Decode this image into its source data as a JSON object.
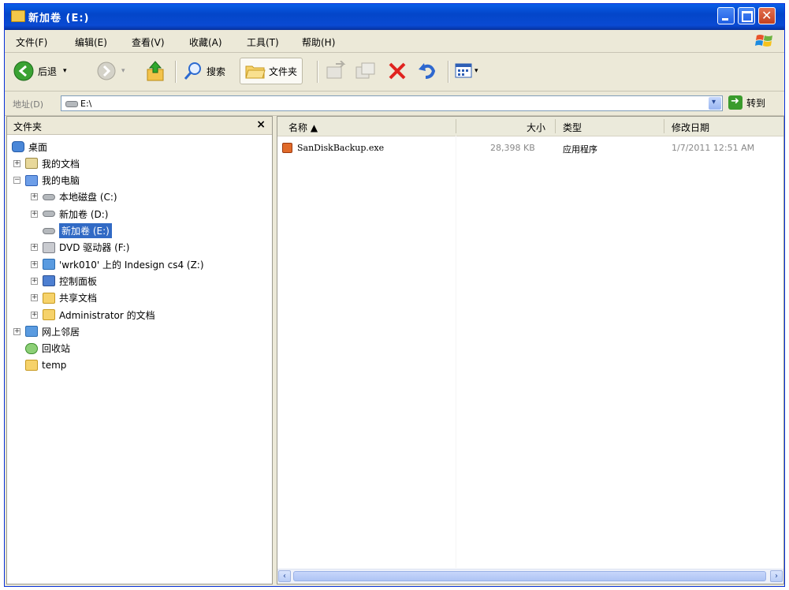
{
  "window": {
    "title": "新加卷 (E:)"
  },
  "menu": {
    "items": [
      "文件(F)",
      "编辑(E)",
      "查看(V)",
      "收藏(A)",
      "工具(T)",
      "帮助(H)"
    ]
  },
  "toolbar": {
    "back": "后退",
    "search": "搜索",
    "folders": "文件夹"
  },
  "address": {
    "label": "地址(D)",
    "value": "E:\\",
    "go": "转到"
  },
  "folder_pane": {
    "title": "文件夹",
    "close": "×",
    "items": [
      {
        "label": "桌面",
        "level": 0,
        "expander": "",
        "icon": "desktop-icon"
      },
      {
        "label": "我的文档",
        "level": 1,
        "expander": "+",
        "icon": "my-documents-icon"
      },
      {
        "label": "我的电脑",
        "level": 1,
        "expander": "−",
        "icon": "my-computer-icon"
      },
      {
        "label": "本地磁盘 (C:)",
        "level": 2,
        "expander": "+",
        "icon": "drive-icon"
      },
      {
        "label": "新加卷 (D:)",
        "level": 2,
        "expander": "+",
        "icon": "drive-icon"
      },
      {
        "label": "新加卷 (E:)",
        "level": 2,
        "expander": "",
        "icon": "drive-icon",
        "selected": true
      },
      {
        "label": "DVD 驱动器 (F:)",
        "level": 2,
        "expander": "+",
        "icon": "dvd-icon"
      },
      {
        "label": "'wrk010' 上的 Indesign cs4 (Z:)",
        "level": 2,
        "expander": "+",
        "icon": "network-drive-icon"
      },
      {
        "label": "控制面板",
        "level": 2,
        "expander": "+",
        "icon": "control-panel-icon"
      },
      {
        "label": "共享文档",
        "level": 2,
        "expander": "+",
        "icon": "folder-icon"
      },
      {
        "label": "Administrator 的文档",
        "level": 2,
        "expander": "+",
        "icon": "folder-icon"
      },
      {
        "label": "网上邻居",
        "level": 1,
        "expander": "+",
        "icon": "network-places-icon"
      },
      {
        "label": "回收站",
        "level": 1,
        "expander": "",
        "icon": "recycle-bin-icon"
      },
      {
        "label": "temp",
        "level": 1,
        "expander": "",
        "icon": "folder-icon"
      }
    ]
  },
  "file_list": {
    "columns": {
      "name": "名称 ▲",
      "size": "大小",
      "type": "类型",
      "modified": "修改日期"
    },
    "rows": [
      {
        "name": "SanDiskBackup.exe",
        "size": "28,398 KB",
        "type": "应用程序",
        "modified": "1/7/2011 12:51 AM"
      }
    ]
  }
}
